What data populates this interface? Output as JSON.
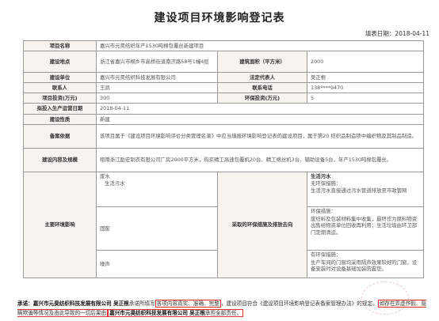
{
  "title": "建设项目环境影响登记表",
  "fill_date": {
    "label": "填表日期：",
    "value": "2018-04-11"
  },
  "rows": {
    "project_name": {
      "label": "项目名称",
      "value": "嘉兴市元昊纺织年产1530吨棉包覆丝新建项目"
    },
    "location": {
      "label": "建设地点",
      "value": "浙江省嘉兴市桐乡市高桥街道南济路58号1幢4层",
      "area_label": "建筑面积（平方米）",
      "area_value": "2000"
    },
    "company": {
      "label": "建设单位",
      "value": "嘉兴市元昊纺织科技发展有限公司",
      "rep_label": "法定代表人",
      "rep_value": "吴正根"
    },
    "contact": {
      "label": "联系人",
      "value": "王凯",
      "phone_label": "联系电话",
      "phone_value": "138****9470"
    },
    "investment": {
      "label": "项目投资(万元)",
      "value": "300",
      "env_label": "环保投资(万元)",
      "env_value": "5"
    },
    "start_date": {
      "label": "拟投入生产运营日期",
      "value": "2018-04-11"
    },
    "nature": {
      "label": "建设性质",
      "value": "新建"
    },
    "basis": {
      "label": "备案依据",
      "value": "该项目属于《建设项目环境影响评价分类管理名录》中应当填报环境影响登记表的建设项目，属于第20 纺织品制造项中编织物及其制品制造。"
    },
    "scale": {
      "label": "建设内容及规模",
      "value": "租用浙江励宏制衣有限公司厂房2000平方米，购买精工高速包覆机20台、精工络丝机3台、辅助设备5台，年产1530吨棉包覆丝。"
    }
  },
  "impact": {
    "label": "主要环境影响",
    "measures_label": "采取的环保措施及排放去向",
    "items": [
      {
        "name": "废水",
        "sub": "生活污水"
      },
      {
        "name": "固废"
      },
      {
        "name": "噪声"
      }
    ],
    "measures": [
      {
        "head": "生活污水",
        "lines": [
          "无环保措施：",
          "生活污水直接通过污水管道排放至市政管网"
        ]
      },
      {
        "head": "",
        "lines": [
          "环保措施：",
          "废纺料及包装材料集中收集，最终作为原料物资出售给物资单位回收再利用；生活垃圾由环卫部门定期清运。"
        ]
      },
      {
        "head": "",
        "lines": [
          "有环保措施：",
          "生产车间的门窗均采用隔声效果较好的门窗，设备安装时对设备基础加装防震垫。"
        ]
      }
    ]
  },
  "promise": {
    "prefix": "承诺：",
    "company": "嘉兴市元昊纺织科技发展有限公司",
    "rep": "吴正根",
    "t1": "承诺所填写",
    "b1": "各项内容真实、准确、完整",
    "t2": "，建设项目符合《建设项目环境影响登记表备案管理办法》的规定。",
    "b2": "如存在弄虚作假、隐瞒欺骗等情况及由此导致的一切后果由",
    "t3": "嘉兴市元昊纺织科技发展有限公司",
    "b3": "吴正根",
    "t4": "承担全部责任。"
  }
}
